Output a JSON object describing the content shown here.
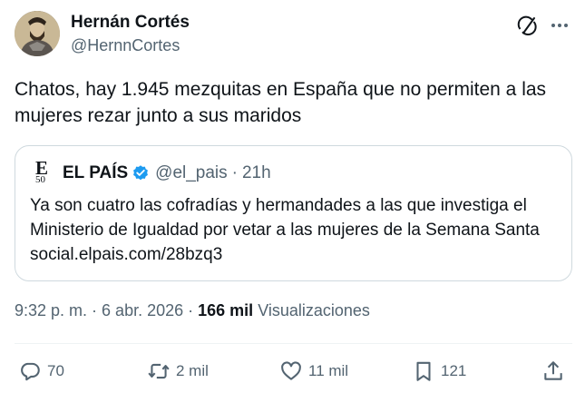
{
  "author": {
    "display_name": "Hernán Cortés",
    "handle": "@HernnCortes"
  },
  "tweet": {
    "text": "Chatos, hay 1.945 mezquitas en España que no permiten a las mujeres rezar junto a sus maridos"
  },
  "quote": {
    "logo_letter": "E",
    "logo_number": "50",
    "name": "EL PAÍS",
    "handle": "@el_pais",
    "separator": "·",
    "time": "21h",
    "text": "Ya son cuatro las cofradías y hermandades a las que investiga el Ministerio de Igualdad por vetar a las mujeres de la Semana Santa social.elpais.com/28bzq3"
  },
  "meta": {
    "time": "9:32 p. m.",
    "separator": "·",
    "date": "6 abr. 2026",
    "views_count": "166 mil",
    "views_label": "Visualizaciones"
  },
  "actions": {
    "replies": "70",
    "reposts": "2 mil",
    "likes": "11 mil",
    "bookmarks": "121"
  },
  "icons": {
    "grok": "grok-icon",
    "more": "more-icon",
    "verified": "verified-badge-icon",
    "reply": "reply-icon",
    "repost": "repost-icon",
    "like": "like-icon",
    "bookmark": "bookmark-icon",
    "share": "share-icon"
  },
  "colors": {
    "text": "#0f1419",
    "secondary": "#536471",
    "verified": "#1d9bf0",
    "border": "#cfd9de"
  }
}
